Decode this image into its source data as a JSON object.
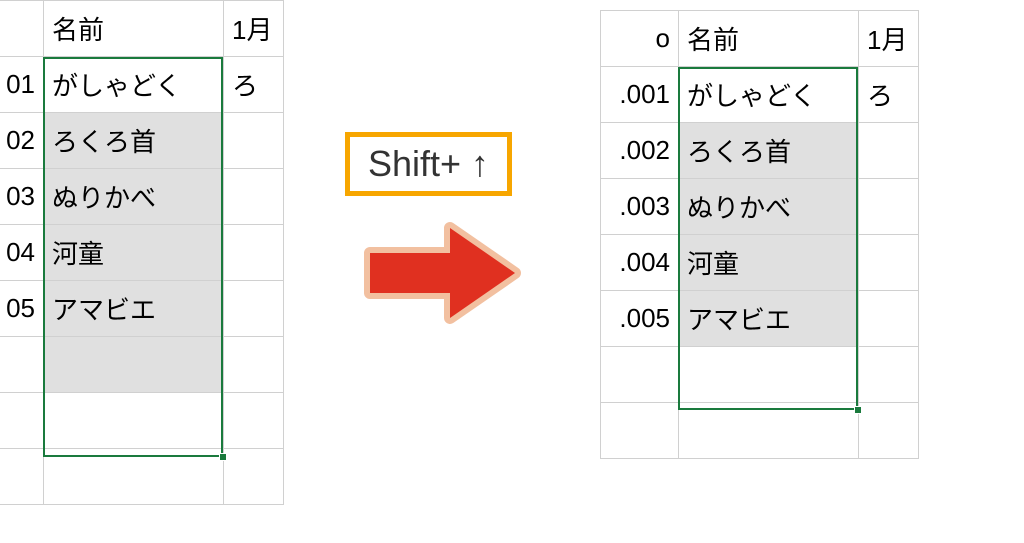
{
  "key_hint": "Shift+ ↑",
  "headers": {
    "col_a": "o",
    "col_b": "名前",
    "col_c": "1月"
  },
  "left_grid": {
    "rows": [
      {
        "idx": "01",
        "name": "がしゃどく",
        "next": "ろ"
      },
      {
        "idx": "02",
        "name": "ろくろ首",
        "next": ""
      },
      {
        "idx": "03",
        "name": "ぬりかべ",
        "next": ""
      },
      {
        "idx": "04",
        "河童_name": "河童",
        "name": "河童",
        "next": ""
      },
      {
        "idx": "05",
        "name": "アマビエ",
        "next": ""
      }
    ]
  },
  "right_grid": {
    "rows": [
      {
        "idx": ".001",
        "name": "がしゃどく",
        "next": "ろ"
      },
      {
        "idx": ".002",
        "name": "ろくろ首",
        "next": ""
      },
      {
        "idx": ".003",
        "name": "ぬりかべ",
        "next": ""
      },
      {
        "idx": ".004",
        "name": "河童",
        "next": ""
      },
      {
        "idx": ".005",
        "name": "アマビエ",
        "next": ""
      }
    ]
  }
}
